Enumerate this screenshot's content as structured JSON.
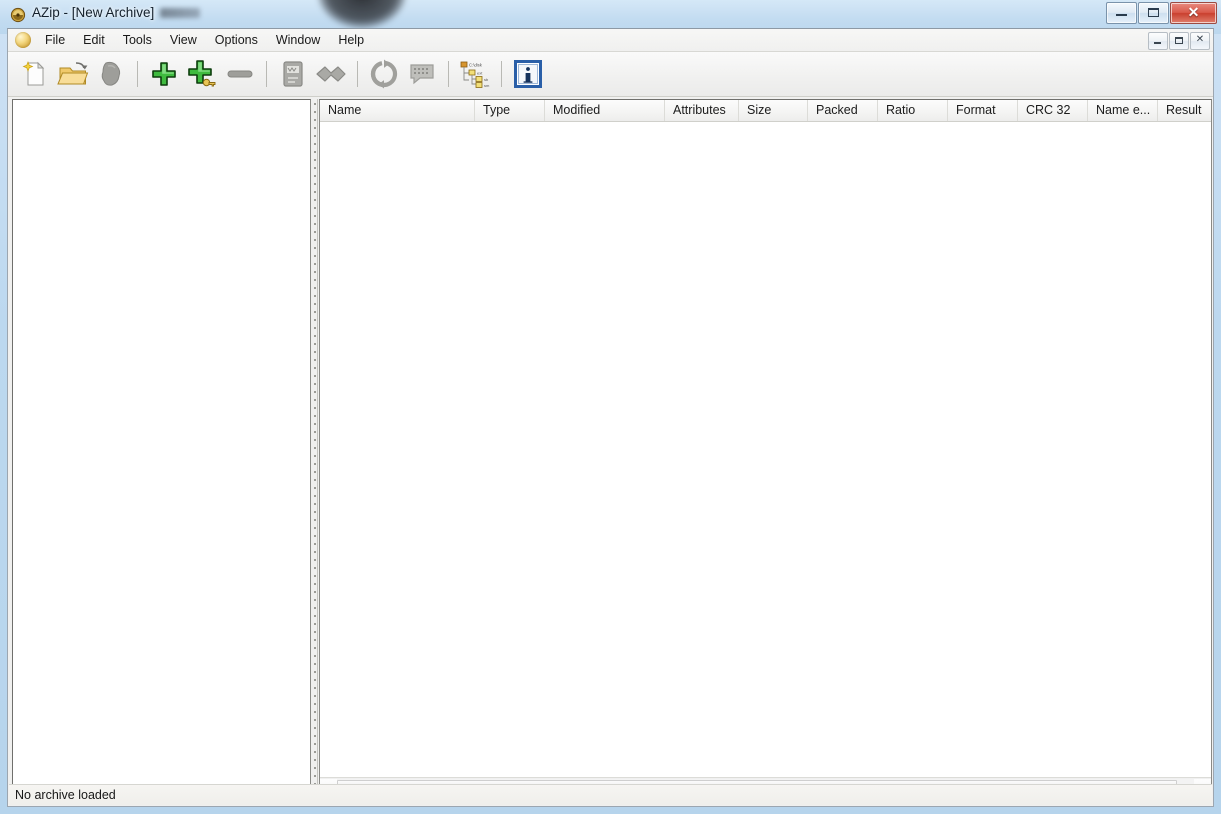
{
  "window": {
    "title": "AZip - [New Archive]",
    "app_icon": "azip-app-icon",
    "controls": [
      {
        "name": "minimize-button",
        "label": "–",
        "icon": "minimize-icon"
      },
      {
        "name": "maximize-button",
        "label": "❐",
        "icon": "maximize-icon"
      },
      {
        "name": "close-button",
        "label": "✕",
        "icon": "close-icon"
      }
    ]
  },
  "menu": {
    "system_icon": "mdi-system-menu-icon",
    "items": [
      {
        "label": "File"
      },
      {
        "label": "Edit"
      },
      {
        "label": "Tools"
      },
      {
        "label": "View"
      },
      {
        "label": "Options"
      },
      {
        "label": "Window"
      },
      {
        "label": "Help"
      }
    ],
    "mdi_controls": [
      {
        "name": "mdi-restore-down-button",
        "icon": "mdi-minimize-icon"
      },
      {
        "name": "mdi-maximize-button",
        "icon": "mdi-restore-icon"
      },
      {
        "name": "mdi-close-button",
        "icon": "mdi-close-icon",
        "label": "✕"
      }
    ]
  },
  "toolbar": {
    "buttons": [
      {
        "name": "new-archive-button",
        "icon": "new-document-icon",
        "tooltip": "New Archive"
      },
      {
        "name": "open-archive-button",
        "icon": "open-folder-icon",
        "tooltip": "Open Archive"
      },
      {
        "name": "close-archive-button",
        "icon": "shape-icon",
        "tooltip": "Close Archive"
      },
      {
        "name": "separator-1",
        "icon": "separator",
        "tooltip": ""
      },
      {
        "name": "add-files-button",
        "icon": "plus-icon",
        "tooltip": "Add Files"
      },
      {
        "name": "add-files-options-button",
        "icon": "plus-key-icon",
        "tooltip": "Add Files with Options"
      },
      {
        "name": "delete-files-button",
        "icon": "minus-icon",
        "tooltip": "Delete Files"
      },
      {
        "name": "separator-2",
        "icon": "separator",
        "tooltip": ""
      },
      {
        "name": "extract-button",
        "icon": "extract-icon",
        "tooltip": "Extract"
      },
      {
        "name": "extract-to-button",
        "icon": "extract-to-icon",
        "tooltip": "Extract To"
      },
      {
        "name": "separator-3",
        "icon": "separator",
        "tooltip": ""
      },
      {
        "name": "refresh-button",
        "icon": "refresh-icon",
        "tooltip": "Refresh"
      },
      {
        "name": "test-archive-button",
        "icon": "test-archive-icon",
        "tooltip": "Test Archive"
      },
      {
        "name": "separator-4",
        "icon": "separator",
        "tooltip": ""
      },
      {
        "name": "tree-view-button",
        "icon": "tree-view-icon",
        "tooltip": "Folder Tree"
      },
      {
        "name": "separator-5",
        "icon": "separator",
        "tooltip": ""
      },
      {
        "name": "info-button",
        "icon": "info-icon",
        "tooltip": "Archive Information"
      }
    ]
  },
  "tree_pane": {
    "items": []
  },
  "file_list": {
    "columns": [
      {
        "label": "Name",
        "width": 155
      },
      {
        "label": "Type",
        "width": 70
      },
      {
        "label": "Modified",
        "width": 120
      },
      {
        "label": "Attributes",
        "width": 74
      },
      {
        "label": "Size",
        "width": 69
      },
      {
        "label": "Packed",
        "width": 70
      },
      {
        "label": "Ratio",
        "width": 70
      },
      {
        "label": "Format",
        "width": 70
      },
      {
        "label": "CRC 32",
        "width": 70
      },
      {
        "label": "Name e...",
        "width": 70
      },
      {
        "label": "Result",
        "width": 68
      }
    ],
    "rows": [],
    "scrollbar": {
      "left_arrow": "scroll-left-arrow-icon",
      "right_arrow": "scroll-right-arrow-icon",
      "thumb_grip": "scroll-thumb-grip"
    }
  },
  "status_bar": {
    "text": "No archive loaded"
  },
  "colors": {
    "glass": "#c3dcf1",
    "client_bg": "#f0f0ef",
    "list_bg": "#ffffff",
    "close_button": "#c9402f",
    "accent_green": "#3cb44a",
    "info_blue": "#2a5fa8"
  }
}
